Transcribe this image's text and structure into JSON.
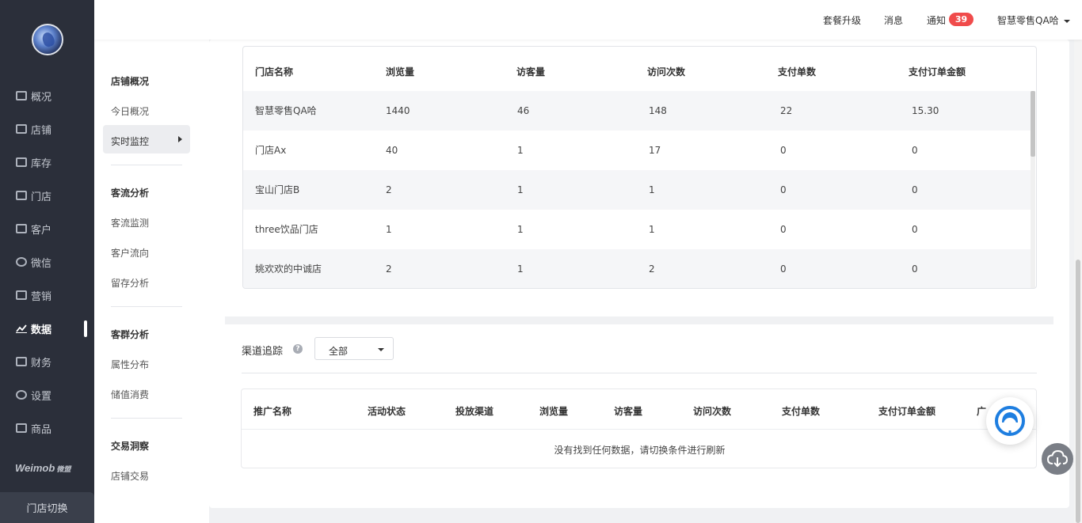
{
  "nav": {
    "items": [
      {
        "label": "概况",
        "icon": "overview-icon"
      },
      {
        "label": "店铺",
        "icon": "shop-icon"
      },
      {
        "label": "库存",
        "icon": "inventory-icon"
      },
      {
        "label": "门店",
        "icon": "store-icon"
      },
      {
        "label": "客户",
        "icon": "customer-icon"
      },
      {
        "label": "微信",
        "icon": "wechat-icon"
      },
      {
        "label": "营销",
        "icon": "marketing-icon"
      },
      {
        "label": "数据",
        "icon": "data-icon"
      },
      {
        "label": "财务",
        "icon": "finance-icon"
      },
      {
        "label": "设置",
        "icon": "settings-icon"
      },
      {
        "label": "商品",
        "icon": "goods-icon"
      }
    ],
    "active": "数据",
    "brand": "Weimob",
    "brand_suffix": "微盟",
    "switch_label": "门店切换"
  },
  "subnav": {
    "groups": [
      {
        "title": "店铺概况",
        "links": [
          "今日概况",
          "实时监控"
        ]
      },
      {
        "title": "客流分析",
        "links": [
          "客流监测",
          "客户流向",
          "留存分析"
        ]
      },
      {
        "title": "客群分析",
        "links": [
          "属性分布",
          "储值消费"
        ]
      },
      {
        "title": "交易洞察",
        "links": [
          "店铺交易"
        ]
      }
    ],
    "selected": "实时监控"
  },
  "topbar": {
    "upgrade": "套餐升级",
    "messages": "消息",
    "notify": "通知",
    "notify_count": "39",
    "account": "智慧零售QA哈"
  },
  "store_table": {
    "headers": [
      "门店名称",
      "浏览量",
      "访客量",
      "访问次数",
      "支付单数",
      "支付订单金额"
    ],
    "rows": [
      [
        "智慧零售QA哈",
        "1440",
        "46",
        "148",
        "22",
        "15.30"
      ],
      [
        "门店Ax",
        "40",
        "1",
        "17",
        "0",
        "0"
      ],
      [
        "宝山门店B",
        "2",
        "1",
        "1",
        "0",
        "0"
      ],
      [
        "three饮品门店",
        "1",
        "1",
        "1",
        "0",
        "0"
      ],
      [
        "姚欢欢的中诚店",
        "2",
        "1",
        "2",
        "0",
        "0"
      ]
    ]
  },
  "channel": {
    "title": "渠道追踪",
    "filter_value": "全部",
    "headers": [
      "推广名称",
      "活动状态",
      "投放渠道",
      "浏览量",
      "访客量",
      "访问次数",
      "支付单数",
      "支付订单金额",
      "广"
    ],
    "empty_text": "没有找到任何数据，请切换条件进行刷新"
  },
  "colors": {
    "nav_bg": "#2b2f3a",
    "badge": "#f04b4b",
    "cs_blue": "#1e7ee0"
  }
}
